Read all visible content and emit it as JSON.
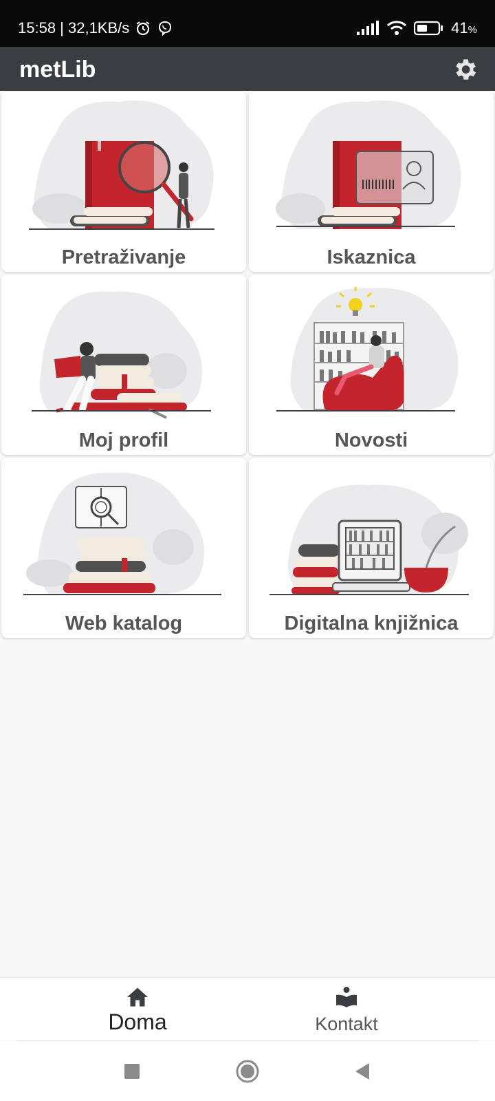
{
  "status_bar": {
    "time_speed": "15:58 | 32,1KB/s",
    "battery": "41",
    "battery_unit": "%",
    "icons": [
      "alarm-icon",
      "viber-icon",
      "signal-icon",
      "wifi-icon",
      "battery-icon"
    ]
  },
  "app_bar": {
    "title": "metLib",
    "settings_icon": "gear-icon"
  },
  "tiles": [
    {
      "label": "Pretraživanje",
      "illustration": "book-magnifier"
    },
    {
      "label": "Iskaznica",
      "illustration": "book-library-card"
    },
    {
      "label": "Moj profil",
      "illustration": "reader-on-books"
    },
    {
      "label": "Novosti",
      "illustration": "reader-lightbulb-bookshelf"
    },
    {
      "label": "Web katalog",
      "illustration": "globe-book-stack"
    },
    {
      "label": "Digitalna knjižnica",
      "illustration": "monitor-bookshelf"
    }
  ],
  "bottom_nav": {
    "items": [
      {
        "label": "Doma",
        "icon": "home-icon",
        "active": true
      },
      {
        "label": "Kontakt",
        "icon": "reader-icon",
        "active": false
      }
    ]
  },
  "system_nav": [
    "recents-icon",
    "home-circle-icon",
    "back-icon"
  ],
  "colors": {
    "accent_red": "#c4242b",
    "app_bar": "#3a3d41",
    "status_bar": "#0a0a0a"
  }
}
